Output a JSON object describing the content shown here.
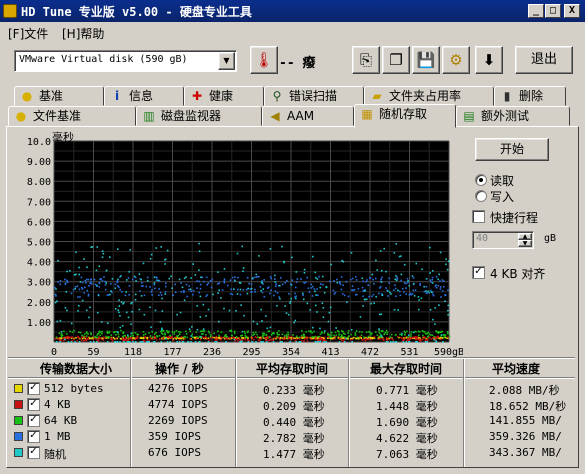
{
  "window": {
    "title": "HD Tune 专业版 v5.00 - 硬盘专业工具",
    "controls": [
      "_",
      "□",
      "X"
    ]
  },
  "menu": [
    {
      "label": "[F]文件"
    },
    {
      "label": "[H]帮助"
    }
  ],
  "toolbar": {
    "drive": "VMware  Virtual disk      (590 gB)",
    "temperature": "-- 癈",
    "exit_label": "退出",
    "icons": [
      "thermometer-icon",
      "copy-text-icon",
      "copy-image-icon",
      "save-icon",
      "options-icon",
      "download-icon"
    ]
  },
  "tabs_row1": [
    {
      "label": "基准",
      "icon": "bulb-icon",
      "glyph": "💡"
    },
    {
      "label": "信息",
      "icon": "info-icon",
      "glyph": "ℹ"
    },
    {
      "label": "健康",
      "icon": "health-cross-icon",
      "glyph": "✚"
    },
    {
      "label": "错误扫描",
      "icon": "magnifier-icon",
      "glyph": "🔍"
    },
    {
      "label": "文件夹占用率",
      "icon": "folder-icon",
      "glyph": "📁"
    },
    {
      "label": "删除",
      "icon": "trash-icon",
      "glyph": "🗑"
    }
  ],
  "tabs_row2": [
    {
      "label": "文件基准",
      "icon": "bulb-icon",
      "glyph": "💡"
    },
    {
      "label": "磁盘监视器",
      "icon": "monitor-chart-icon",
      "glyph": "▥"
    },
    {
      "label": "AAM",
      "icon": "speaker-icon",
      "glyph": "🔈"
    },
    {
      "label": "随机存取",
      "icon": "random-access-icon",
      "glyph": "▦",
      "active": true
    },
    {
      "label": "额外测试",
      "icon": "extra-tests-icon",
      "glyph": "▤"
    }
  ],
  "controls": {
    "start_label": "开始",
    "read_label": "读取",
    "write_label": "写入",
    "read_selected": true,
    "quick_stroke_label": "快捷行程",
    "quick_stroke_checked": false,
    "stroke_value": "40",
    "stroke_unit": "gB",
    "align_label": "4 KB 对齐",
    "align_checked": true
  },
  "chart_data": {
    "type": "scatter",
    "ylabel": "毫秒",
    "y_ticks": [
      "10.0",
      "9.00",
      "8.00",
      "7.00",
      "6.00",
      "5.00",
      "4.00",
      "3.00",
      "2.00",
      "1.00"
    ],
    "x_ticks": [
      "0",
      "59",
      "118",
      "177",
      "236",
      "295",
      "354",
      "413",
      "472",
      "531",
      "590gB"
    ],
    "xlim": [
      0,
      590
    ],
    "ylim": [
      0,
      10
    ],
    "grid": true,
    "background": "#000000",
    "series": [
      {
        "name": "512 bytes",
        "color": "#e5d800",
        "mean_ms": 0.233,
        "max_ms": 0.771
      },
      {
        "name": "4 KB",
        "color": "#c81010",
        "mean_ms": 0.209,
        "max_ms": 1.448
      },
      {
        "name": "64 KB",
        "color": "#18c018",
        "mean_ms": 0.44,
        "max_ms": 1.69
      },
      {
        "name": "1 MB",
        "color": "#2870e0",
        "mean_ms": 2.782,
        "max_ms": 4.622
      },
      {
        "name": "随机",
        "color": "#20c8c8",
        "mean_ms": 1.477,
        "max_ms": 7.063
      }
    ]
  },
  "table": {
    "headers": [
      "传输数据大小",
      "操作 / 秒",
      "平均存取时间",
      "最大存取时间",
      "平均速度"
    ],
    "rows": [
      {
        "label": "512 bytes",
        "color": "#e5d800",
        "ops": "4276 IOPS",
        "avg": "0.233 毫秒",
        "max": "0.771 毫秒",
        "speed": "2.088 MB/秒",
        "checked": true
      },
      {
        "label": "4 KB",
        "color": "#c81010",
        "ops": "4774 IOPS",
        "avg": "0.209 毫秒",
        "max": "1.448 毫秒",
        "speed": "18.652 MB/秒",
        "checked": true
      },
      {
        "label": "64 KB",
        "color": "#18c018",
        "ops": "2269 IOPS",
        "avg": "0.440 毫秒",
        "max": "1.690 毫秒",
        "speed": "141.855 MB/",
        "checked": true
      },
      {
        "label": "1 MB",
        "color": "#2870e0",
        "ops": "359 IOPS",
        "avg": "2.782 毫秒",
        "max": "4.622 毫秒",
        "speed": "359.326 MB/",
        "checked": true
      },
      {
        "label": "随机",
        "color": "#20c8c8",
        "ops": "676 IOPS",
        "avg": "1.477 毫秒",
        "max": "7.063 毫秒",
        "speed": "343.367 MB/",
        "checked": true
      }
    ]
  }
}
